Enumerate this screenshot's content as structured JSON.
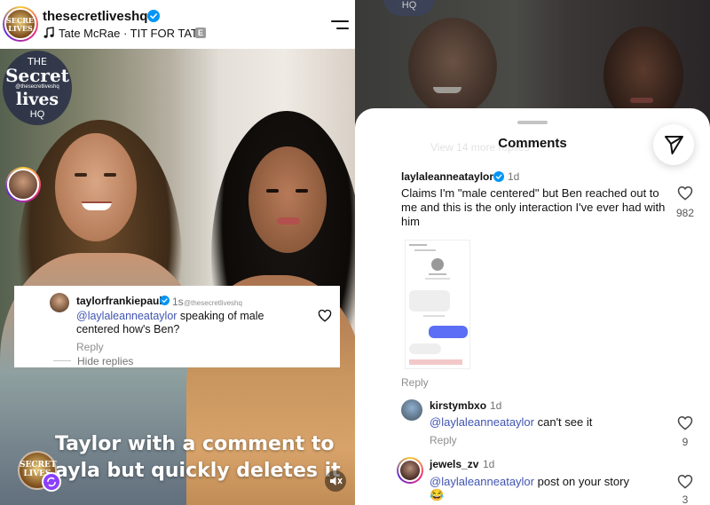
{
  "post": {
    "username": "thesecretliveshq",
    "song": "Tate McRae · TIT FOR TAT",
    "explicit_label": "E",
    "avatar_text": "SECRET LIVES",
    "logo": {
      "the": "THE",
      "secret": "Secret",
      "handle": "@thesecretliveshq",
      "lives": "lives",
      "hq": "HQ"
    },
    "caption_line1": "Taylor with a comment to",
    "caption_line2": "ayla but quickly deletes it",
    "bottom_avatar_text": "SECRET LIVES"
  },
  "overlay_comment": {
    "username": "taylorfrankiepaul",
    "time": "1s",
    "watermark": "@thesecretliveshq",
    "mention": "@laylaleanneataylor",
    "text": " speaking of male centered how's Ben?",
    "reply_label": "Reply",
    "hide_replies_label": "Hide replies"
  },
  "comments_sheet": {
    "title": "Comments",
    "background_hq": "HQ",
    "ghost_text": "View 14 more replies",
    "comments": [
      {
        "username": "laylaleanneataylor",
        "verified": true,
        "time": "1d",
        "text": "Claims I'm \"male centered\" but Ben reached out to me and this is the only interaction I've ever had with him",
        "likes": "982",
        "reply_label": "Reply"
      },
      {
        "username": "kirstymbxo",
        "time": "1d",
        "mention": "@laylaleanneataylor",
        "text": " can't see it",
        "likes": "9",
        "reply_label": "Reply"
      },
      {
        "username": "jewels_zv",
        "time": "1d",
        "mention": "@laylaleanneataylor",
        "text": " post on your story",
        "emoji": "😂",
        "likes": "3"
      }
    ]
  },
  "colors": {
    "verified": "#0095f6",
    "mention": "#4054b2",
    "muted_text": "#737373",
    "remix_badge": "#8a3ffc"
  },
  "icons": [
    "music-note-icon",
    "verified-badge-icon",
    "menu-icon",
    "heart-icon",
    "send-icon",
    "mute-icon",
    "remix-icon"
  ]
}
